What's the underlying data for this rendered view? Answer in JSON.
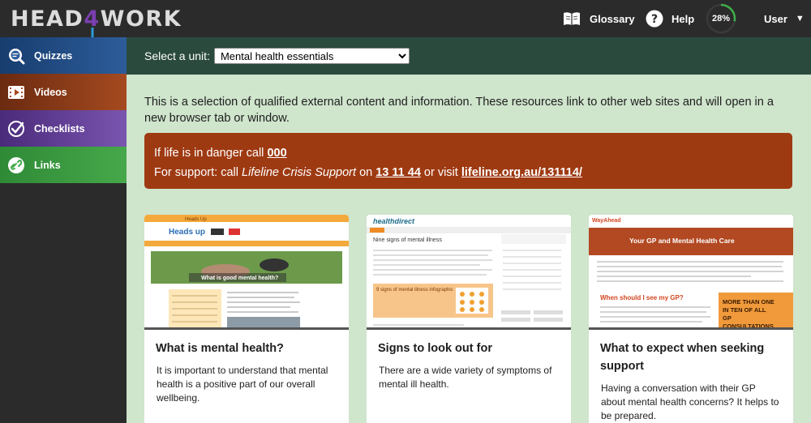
{
  "header": {
    "logo_left": "HEAD",
    "logo_mid": "4",
    "logo_right": "WORK",
    "glossary_label": "Glossary",
    "help_label": "Help",
    "progress_text": "28%",
    "progress_value": 0.28,
    "user_label": "User"
  },
  "sidebar": {
    "items": [
      {
        "label": "Quizzes"
      },
      {
        "label": "Videos"
      },
      {
        "label": "Checklists"
      },
      {
        "label": "Links"
      }
    ]
  },
  "unit_selector": {
    "label": "Select a unit:",
    "selected": "Mental health essentials"
  },
  "intro": "This is a selection of qualified external content and information. These resources link to other web sites and will open in a new browser tab or window.",
  "alert": {
    "line1_prefix": "If life is in danger call ",
    "line1_number": "000",
    "line2_prefix": "For support: call ",
    "line2_service": "Lifeline Crisis Support",
    "line2_on": " on ",
    "line2_number": "13 11 44",
    "line2_visit": " or visit ",
    "line2_url": "lifeline.org.au/131114/"
  },
  "cards": [
    {
      "title": "What is mental health?",
      "desc": "It is important to understand that mental health is a positive part of our overall wellbeing.",
      "thumb": {
        "banner": "Heads Up",
        "brand": "Heads up",
        "heading": "What is good mental health?"
      }
    },
    {
      "title": "Signs to look out for",
      "desc": "There are a wide variety of symptoms of mental ill health.",
      "thumb": {
        "brand": "healthdirect",
        "heading": "Nine signs of mental illness",
        "box": "9 signs of mental illness infographic"
      }
    },
    {
      "title": "What to expect when seeking support",
      "desc": "Having a conversation with their GP about mental health concerns? It helps to be prepared.",
      "thumb": {
        "brand": "WayAhead",
        "banner": "Your GP and Mental Health Care",
        "question": "When should I see my GP?",
        "stat": "MORE THAN ONE IN TEN OF ALL GP CONSULTATIONS"
      }
    }
  ],
  "colors": {
    "topbar": "#2b2b2b",
    "unitbar": "#2b4a3e",
    "content_bg": "#cfe5cc",
    "alert": "#9e3a12",
    "quizzes": "#2d5c9a",
    "videos": "#a54a20",
    "checklists": "#7a55b0",
    "links": "#46a84a",
    "progress_ring": "#3fb04a"
  }
}
